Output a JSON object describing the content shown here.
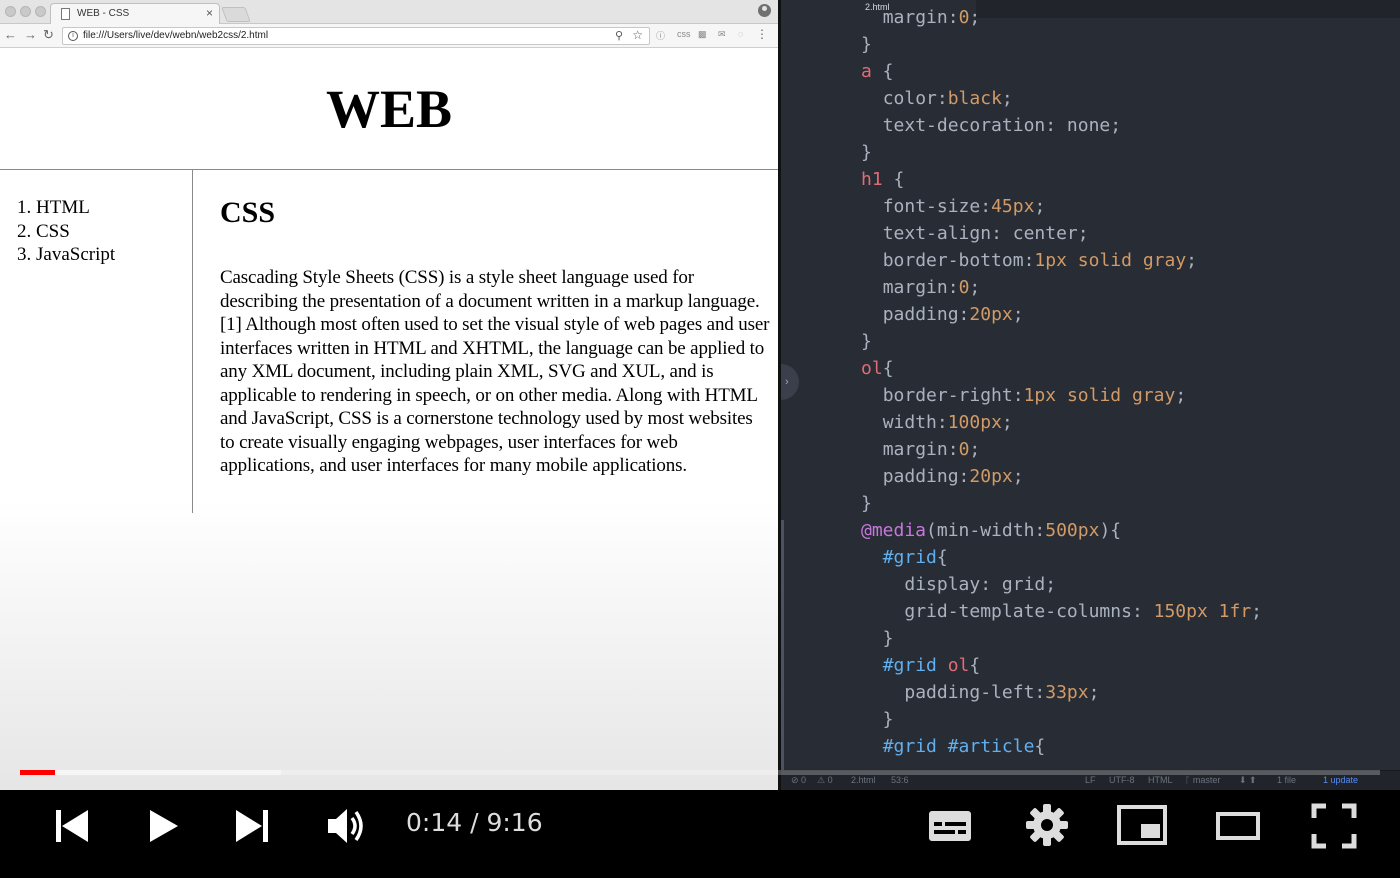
{
  "browser": {
    "tab_title": "WEB - CSS",
    "tab_close": "×",
    "url": "file:///Users/live/dev/webn/web2css/2.html",
    "ext_css_label": "css"
  },
  "page": {
    "heading": "WEB",
    "nav_items": [
      "1. HTML",
      "2. CSS",
      "3. JavaScript"
    ],
    "article_title": "CSS",
    "article_body": "Cascading Style Sheets (CSS) is a style sheet language used for describing the presentation of a document written in a markup language.[1] Although most often used to set the visual style of web pages and user interfaces written in HTML and XHTML, the language can be applied to any XML document, including plain XML, SVG and XUL, and is applicable to rendering in speech, or on other media. Along with HTML and JavaScript, CSS is a cornerstone technology used by most websites to create visually engaging webpages, user interfaces for web applications, and user interfaces for many mobile applications."
  },
  "editor": {
    "tab_title": "2.html",
    "code_lines": [
      "  margin:0;",
      "}",
      "a {",
      "  color:black;",
      "  text-decoration: none;",
      "}",
      "h1 {",
      "  font-size:45px;",
      "  text-align: center;",
      "  border-bottom:1px solid gray;",
      "  margin:0;",
      "  padding:20px;",
      "}",
      "ol{",
      "  border-right:1px solid gray;",
      "  width:100px;",
      "  margin:0;",
      "  padding:20px;",
      "}",
      "@media(min-width:500px){",
      "  #grid{",
      "    display: grid;",
      "    grid-template-columns: 150px 1fr;",
      "  }",
      "  #grid ol{",
      "    padding-left:33px;",
      "  }",
      "  #grid #article{"
    ],
    "status": {
      "errors": "⊘ 0",
      "warnings": "⚠ 0",
      "file": "2.html",
      "cursor": "53:6",
      "line_ending": "LF",
      "encoding": "UTF-8",
      "grammar": "HTML",
      "branch": "ᚴ master",
      "arrows": "⬇ ⬆",
      "files": "1 file",
      "update": "1 update"
    }
  },
  "player": {
    "time": "0:14 / 9:16",
    "played_fraction": 0.0255,
    "buffered_fraction": 0.192
  }
}
